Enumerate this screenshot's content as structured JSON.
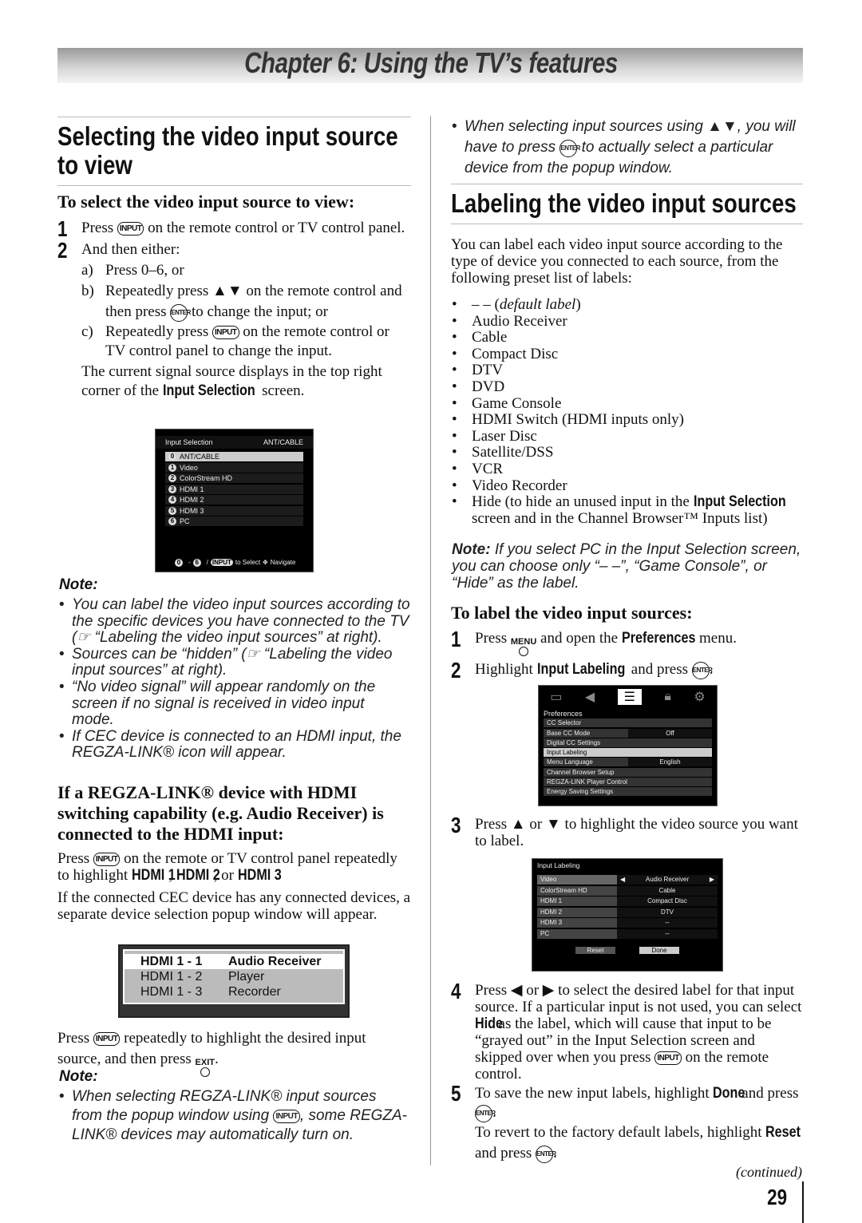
{
  "header": {
    "chapter": "Chapter 6: Using the TV’s features"
  },
  "left": {
    "title": [
      "Selecting the video input source",
      "to view"
    ],
    "subtitle": "To select the video input source to view:",
    "step1": [
      {
        "t": "Press "
      },
      {
        "t": "INPUT",
        "s": "btn"
      },
      {
        "t": " on the remote control or TV control panel."
      }
    ],
    "step2": "And then either:",
    "a": [
      {
        "t": "Press 0–6, or"
      }
    ],
    "b": [
      {
        "t": "Repeatedly press ▲▼ on the remote control and then press "
      },
      {
        "t": "ENTER",
        "s": "round"
      },
      {
        "t": " to change the input; or"
      }
    ],
    "c": [
      {
        "t": "Repeatedly press "
      },
      {
        "t": "INPUT",
        "s": "btn"
      },
      {
        "t": " on the remote control or TV control panel to change the input."
      }
    ],
    "para": [
      {
        "t": "The current signal source displays in the top right corner of the "
      },
      {
        "t": "Input Selection",
        "s": "cb"
      },
      {
        "t": " screen."
      }
    ],
    "screen": {
      "title": "Input Selection",
      "source": "ANT/CABLE",
      "items": [
        [
          "0",
          "ANT/CABLE"
        ],
        [
          "1",
          "Video"
        ],
        [
          "2",
          "ColorStream HD"
        ],
        [
          "3",
          "HDMI 1"
        ],
        [
          "4",
          "HDMI 2"
        ],
        [
          "5",
          "HDMI 3"
        ],
        [
          "6",
          "PC"
        ]
      ],
      "footer": {
        "k0": "0",
        "dash": "-",
        "k6": "6",
        "slash": "/",
        "input": "INPUT",
        "select": "to Select",
        "navigate": "Navigate"
      }
    },
    "note_label": "Note:",
    "notes": [
      "You can label the video input sources according to the specific devices you have connected to the TV (☞ “Labeling the video input sources” at right).",
      "Sources can be “hidden” (☞ “Labeling the video input sources” at right).",
      "“No video signal” will appear randomly on the screen if no signal is received in video input mode.",
      "If CEC device is connected to an HDMI input, the REGZA-LINK® icon will appear."
    ],
    "regza_title": "If a REGZA-LINK® device with HDMI switching capability (e.g. Audio Receiver) is connected to the HDMI input:",
    "p1": [
      {
        "t": "Press "
      },
      {
        "t": "INPUT",
        "s": "btn"
      },
      {
        "t": " on the remote or TV control panel repeatedly to highlight "
      },
      {
        "t": "HDMI 1",
        "s": "cb"
      },
      {
        "t": ", "
      },
      {
        "t": "HDMI 2",
        "s": "cb"
      },
      {
        "t": ", or "
      },
      {
        "t": "HDMI 3",
        "s": "cb"
      },
      {
        "t": "."
      }
    ],
    "p2": "If the connected CEC device has any connected devices, a separate device selection popup window will appear.",
    "popup": [
      [
        "HDMI 1 -  1",
        "Audio Receiver"
      ],
      [
        "HDMI 1 -  2",
        "Player"
      ],
      [
        "HDMI 1 -  3",
        "Recorder"
      ]
    ],
    "p3": [
      {
        "t": "Press "
      },
      {
        "t": "INPUT",
        "s": "btn"
      },
      {
        "t": " repeatedly to highlight the desired input source, and then press "
      },
      {
        "t": "EXIT",
        "s": "stk"
      },
      {
        "t": "."
      }
    ],
    "note2_label": "Note:",
    "note2": [
      {
        "t": "When selecting REGZA-LINK® input sources from the popup window using "
      },
      {
        "t": "INPUT",
        "s": "btn"
      },
      {
        "t": ", some REGZA-LINK® devices may automatically turn on."
      }
    ]
  },
  "right": {
    "top_note": [
      {
        "t": "When selecting input sources using ▲▼, you will have to press "
      },
      {
        "t": "ENTER",
        "s": "round"
      },
      {
        "t": " to actually select a particular device from the popup window."
      }
    ],
    "title": "Labeling the video input sources",
    "intro": "You can label each video input source according to the type of device you connected to each source, from the following preset list of labels:",
    "labels": [
      [
        {
          "t": "– – ("
        },
        {
          "t": "default label",
          "s": "i"
        },
        {
          "t": ")"
        }
      ],
      [
        {
          "t": "Audio Receiver"
        }
      ],
      [
        {
          "t": "Cable"
        }
      ],
      [
        {
          "t": "Compact Disc"
        }
      ],
      [
        {
          "t": "DTV"
        }
      ],
      [
        {
          "t": "DVD"
        }
      ],
      [
        {
          "t": "Game Console"
        }
      ],
      [
        {
          "t": "HDMI Switch (HDMI inputs only)"
        }
      ],
      [
        {
          "t": "Laser Disc"
        }
      ],
      [
        {
          "t": "Satellite/DSS"
        }
      ],
      [
        {
          "t": "VCR"
        }
      ],
      [
        {
          "t": "Video Recorder"
        }
      ],
      [
        {
          "t": "Hide (to hide an unused input in the "
        },
        {
          "t": "Input Selection",
          "s": "cb"
        },
        {
          "t": " screen and in the Channel Browser™ Inputs list)"
        }
      ]
    ],
    "note": [
      {
        "t": "Note:",
        "s": "nb"
      },
      {
        "t": " If you select PC in the Input Selection screen, you can choose only “– –”, “Game Console”, or “Hide” as the label."
      }
    ],
    "subtitle": "To label the video input sources:",
    "step1": [
      {
        "t": "Press "
      },
      {
        "t": "MENU",
        "s": "stk"
      },
      {
        "t": " and open the "
      },
      {
        "t": "Preferences",
        "s": "cb"
      },
      {
        "t": " menu."
      }
    ],
    "step2": [
      {
        "t": "Highlight "
      },
      {
        "t": "Input Labeling",
        "s": "cb"
      },
      {
        "t": " and press "
      },
      {
        "t": "ENTER",
        "s": "round"
      },
      {
        "t": "."
      }
    ],
    "prefs": {
      "title": "Preferences",
      "items": [
        [
          "CC Selector",
          ""
        ],
        [
          "Base CC Mode",
          "Off"
        ],
        [
          "Digital CC Settings",
          ""
        ],
        [
          "Input Labeling",
          ""
        ],
        [
          "Menu Language",
          "English"
        ],
        [
          "Channel Browser Setup",
          ""
        ],
        [
          "REGZA-LINK Player Control",
          ""
        ],
        [
          "Energy Saving Settings",
          ""
        ]
      ],
      "selected": "Input Labeling"
    },
    "step3": "Press ▲ or ▼ to highlight the video source you want to label.",
    "labeling": {
      "title": "Input Labeling",
      "rows": [
        [
          "Video",
          "Audio Receiver"
        ],
        [
          "ColorStream HD",
          "Cable"
        ],
        [
          "HDMI 1",
          "Compact Disc"
        ],
        [
          "HDMI 2",
          "DTV"
        ],
        [
          "HDMI 3",
          "--"
        ],
        [
          "PC",
          "--"
        ]
      ],
      "reset": "Reset",
      "done": "Done"
    },
    "step4": [
      {
        "t": "Press ◀ or ▶ to select the desired label for that input source. If a particular input is not used, you can select "
      },
      {
        "t": "Hide",
        "s": "cb"
      },
      {
        "t": " as the label, which will cause that input to be “grayed out” in the Input Selection screen and skipped over when you press "
      },
      {
        "t": "INPUT",
        "s": "btn"
      },
      {
        "t": " on the remote control."
      }
    ],
    "step5": [
      {
        "t": "To save the new input labels, highlight "
      },
      {
        "t": "Done",
        "s": "cb"
      },
      {
        "t": " and press "
      },
      {
        "t": "ENTER",
        "s": "round"
      },
      {
        "t": "."
      }
    ],
    "step5b": [
      {
        "t": "To revert to the factory default labels, highlight "
      },
      {
        "t": "Reset",
        "s": "cb"
      },
      {
        "t": " and press "
      },
      {
        "t": "ENTER",
        "s": "round"
      },
      {
        "t": "."
      }
    ],
    "continued": "(continued)",
    "page": "29"
  }
}
